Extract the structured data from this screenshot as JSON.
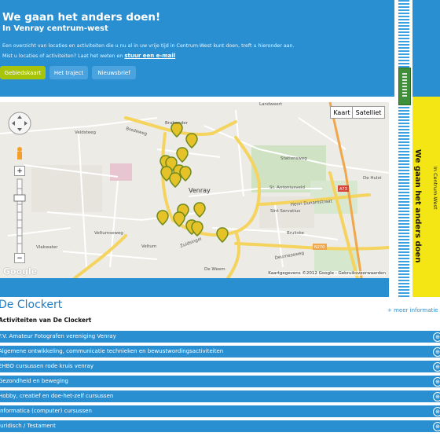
{
  "hero": {
    "title": "We gaan het anders doen!",
    "subtitle": "In Venray centrum-west",
    "intro_line1": "Een overzicht van locaties en activiteiten die u nu al in uw vrije tijd in Centrum-West kunt doen, treft u hieronder aan.",
    "intro_line2": "Mist u locaties of activiteiten? Laat het weten en",
    "intro_link": "stuur een e-mail",
    "buttons": [
      {
        "label": "Gebiedskaart",
        "active": true
      },
      {
        "label": "Het traject",
        "active": false
      },
      {
        "label": "Nieuwsbrief",
        "active": false
      }
    ]
  },
  "side_panel": {
    "title": "We gaan het anders doen",
    "subtitle": "In Centrum-West"
  },
  "map": {
    "type_buttons": [
      "Kaart",
      "Satelliet"
    ],
    "logo": "Google",
    "attribution": "Kaartgegevens ©2012 Google - Gebruiksvoorwaarden",
    "zoom_plus": "+",
    "zoom_minus": "−",
    "place_labels": {
      "center": "Venray",
      "brabander": "Brabander",
      "landweert": "Landweert",
      "bredeweg": "Bredeweg",
      "stationsweg": "Stationsweg",
      "antoniusveld": "St. Antoniusveld",
      "henri": "Henri Dunantstraat",
      "servatius": "Sint Servatius",
      "brukske": "Brukske",
      "veltum": "Veltum",
      "vlakwater": "Vlakwater",
      "deurneseweg": "Deurneseweg",
      "zuidsingel": "Zuidsingel",
      "veltumseweg": "Veltumseweg",
      "a73": "A73",
      "n270": "N270",
      "weem": "De Weem",
      "hulst": "De Hulst",
      "velldsteeg": "Veldsteeg"
    },
    "marker_color": "#e6c229"
  },
  "location": {
    "title": "De Clockert",
    "subtitle": "Activiteiten van De Clockert",
    "more_link": "+ meer informatie",
    "rows": [
      "F.V. Amateur Fotografen vereniging Venray",
      "Algemene ontwikkeling, communicatie technieken en bewustwordingsactiviteiten",
      "EHBO cursussen rode kruis venray",
      "Gezondheid en beweging",
      "Hobby, creatief en doe-het-zelf cursussen",
      "Informatica (computer) cursussen",
      "Juridisch / Testament"
    ],
    "row_icon": "⊕"
  },
  "colors": {
    "brand_blue": "#2a8fd0",
    "accent_green": "#a8c40a",
    "panel_yellow": "#f4e614"
  }
}
